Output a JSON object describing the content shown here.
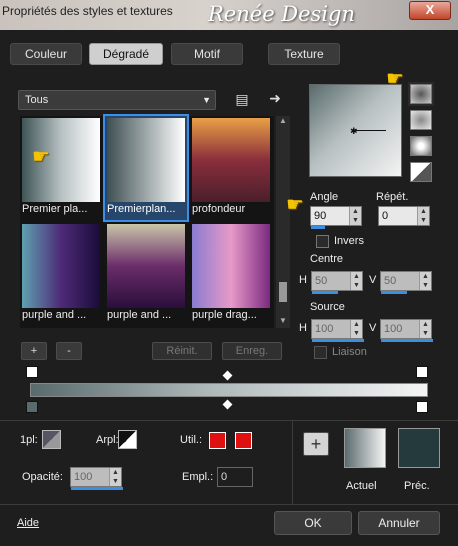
{
  "window": {
    "title": "Propriétés des styles et textures",
    "watermark": "Renée Design",
    "close": "X"
  },
  "tabs": [
    {
      "label": "Couleur"
    },
    {
      "label": "Dégradé"
    },
    {
      "label": "Motif"
    },
    {
      "label": "Texture"
    }
  ],
  "category": {
    "value": "Tous"
  },
  "presets": [
    {
      "label": "Premier pla...",
      "colors": [
        "#3f5456",
        "#b7c1c2",
        "#ffffff"
      ]
    },
    {
      "label": "Premierplan...",
      "colors": [
        "#3f4f52",
        "#9ea7a8",
        "#ffffff"
      ]
    },
    {
      "label": "profondeur",
      "colors": [
        "#e9a046",
        "#8a2e3c",
        "#4a1f2a"
      ]
    },
    {
      "label": "purple and ...",
      "colors": [
        "#5fa0b0",
        "#4e2a78",
        "#1a0c3a"
      ]
    },
    {
      "label": "purple and ...",
      "colors": [
        "#c9c6a8",
        "#6b2d6b",
        "#2a0e3a"
      ]
    },
    {
      "label": "purple drag...",
      "colors": [
        "#8a7cd0",
        "#e79ac8",
        "#7a2a80"
      ]
    }
  ],
  "buttons": {
    "add": "+",
    "remove": "-",
    "reset": "Réinit.",
    "save": "Enreg.",
    "ok": "OK",
    "cancel": "Annuler",
    "help": "Aide",
    "new_swatch": "+"
  },
  "angle": {
    "label": "Angle",
    "value": "90"
  },
  "repeat": {
    "label": "Répét.",
    "value": "0"
  },
  "invert": {
    "label": "Invers"
  },
  "center": {
    "label": "Centre",
    "h_label": "H",
    "h": "50",
    "v_label": "V",
    "v": "50"
  },
  "source": {
    "label": "Source",
    "h_label": "H",
    "h": "100",
    "v_label": "V",
    "v": "100"
  },
  "link": {
    "label": "Liaison"
  },
  "bottom": {
    "fg_label": "1pl:",
    "arpl_label": "Arpl:",
    "util_label": "Util.:",
    "opacity_label": "Opacité:",
    "opacity_value": "100",
    "empl_label": "Empl.:",
    "empl_value": "0",
    "actual_label": "Actuel",
    "prev_label": "Préc."
  },
  "colors": {
    "selected": "#3d8ee6",
    "accent_red": "#e01010",
    "prev_swatch": "#243a3c"
  }
}
